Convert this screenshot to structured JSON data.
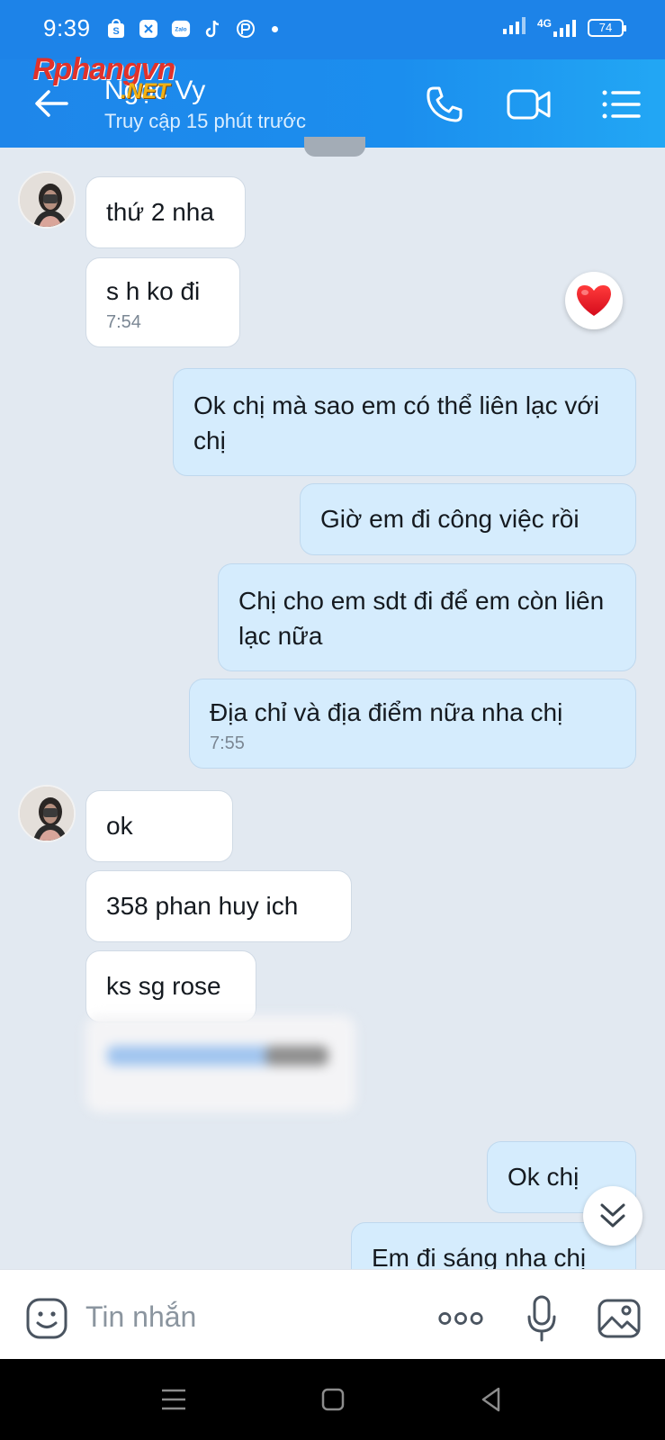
{
  "status_bar": {
    "time": "9:39",
    "apps": [
      "shopee-icon",
      "app-icon",
      "zalo-icon",
      "tiktok-icon",
      "pet-app-icon"
    ],
    "network": "4G",
    "battery": "74"
  },
  "header": {
    "watermark_main": "Rphangvn",
    "watermark_sub": ".NET",
    "contact_name": "Ngọc Vy",
    "contact_status": "Truy cập 15 phút trước"
  },
  "messages": {
    "m1": "thứ 2 nha",
    "m2": "s h ko đi",
    "m2_time": "7:54",
    "m3": "Ok chị mà sao em có thể liên lạc với chị",
    "m4": "Giờ em đi công việc rồi",
    "m5": "Chị cho em sdt đi để em còn liên lạc nữa",
    "m6": "Địa chỉ và địa điểm nữa nha chị",
    "m6_time": "7:55",
    "m7": "ok",
    "m8": "358 phan huy ich",
    "m9": "ks sg rose",
    "m10": "Ok chị",
    "m11": "Em đi sáng nha chị"
  },
  "reaction": "heart",
  "input": {
    "placeholder": "Tin nhắn"
  },
  "colors": {
    "header": "#1d83e8",
    "outgoing_bubble": "#d5ecfd",
    "incoming_bubble": "#ffffff",
    "chat_bg": "#e2e9f1"
  }
}
